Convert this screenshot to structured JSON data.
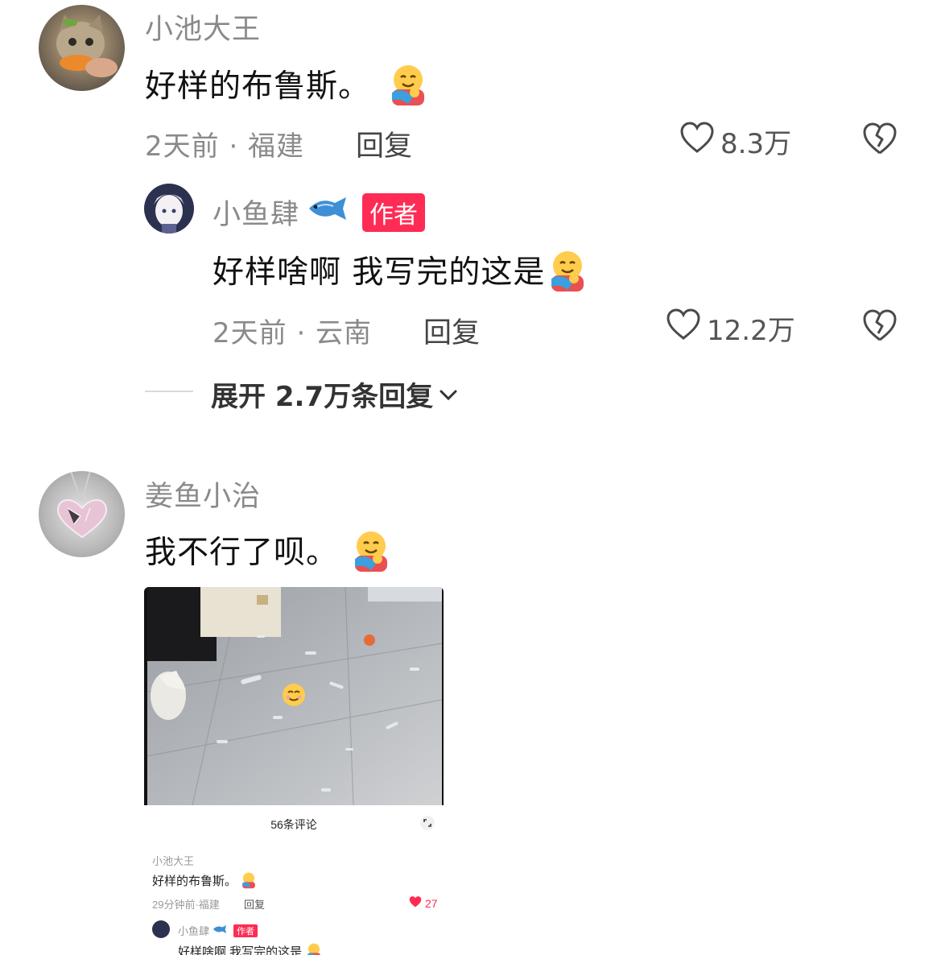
{
  "comment1": {
    "username": "小池大王",
    "text": "好样的布鲁斯。",
    "time_location": "2天前 · 福建",
    "reply_label": "回复",
    "likes": "8.3万"
  },
  "reply1": {
    "username": "小鱼肆",
    "badge": "作者",
    "text": "好样啥啊 我写完的这是",
    "time_location": "2天前 · 云南",
    "reply_label": "回复",
    "likes": "12.2万"
  },
  "expand": {
    "label": "展开 2.7万条回复"
  },
  "comment2": {
    "username": "姜鱼小治",
    "text": "我不行了呗。",
    "screenshot": {
      "count_label": "56条评论",
      "c1_user": "小池大王",
      "c1_text": "好样的布鲁斯。",
      "c1_meta": "29分钟前·福建",
      "c1_reply": "回复",
      "c1_likes": "27",
      "c2_user": "小鱼肆",
      "c2_badge": "作者",
      "c2_text": "好样啥啊 我写完的这是"
    }
  },
  "icons": {
    "heart": "heart-outline-icon",
    "broken_heart": "broken-heart-icon",
    "fish": "fish-emoji-icon",
    "hug": "hugging-face-emoji-icon",
    "chevron": "chevron-down-icon",
    "smile": "smiling-face-emoji-icon"
  },
  "colors": {
    "badge": "#fe2c55",
    "meta": "#8a8a8a",
    "like_red": "#fe2c55"
  }
}
